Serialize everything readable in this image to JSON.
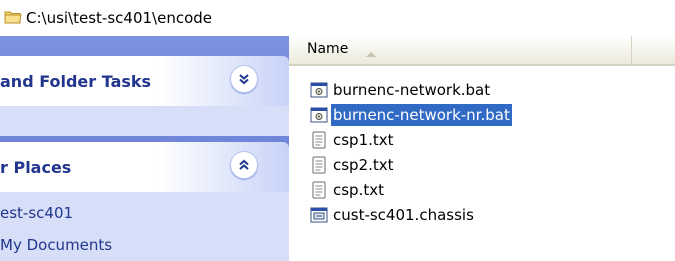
{
  "address": {
    "path": "C:\\usi\\test-sc401\\encode",
    "icon": "folder-icon"
  },
  "taskpane": {
    "tasks_title": "and Folder Tasks",
    "tasks_button_icon": "double-chevron-down-icon",
    "places_title": "r Places",
    "places_button_icon": "double-chevron-up-icon",
    "places": [
      "est-sc401",
      "My Documents"
    ]
  },
  "filelist": {
    "column_name": "Name",
    "sort_icon": "sort-ascending-icon",
    "files": [
      {
        "name": "burnenc-network.bat",
        "icon": "batch-file-icon",
        "selected": false
      },
      {
        "name": "burnenc-network-nr.bat",
        "icon": "batch-file-icon",
        "selected": true
      },
      {
        "name": "csp1.txt",
        "icon": "text-file-icon",
        "selected": false
      },
      {
        "name": "csp2.txt",
        "icon": "text-file-icon",
        "selected": false
      },
      {
        "name": "csp.txt",
        "icon": "text-file-icon",
        "selected": false
      },
      {
        "name": "cust-sc401.chassis",
        "icon": "generic-file-icon",
        "selected": false
      }
    ]
  },
  "colors": {
    "selection": "#316ac5",
    "taskpane_bg": "#6b82d6",
    "header_text": "#21368c"
  }
}
